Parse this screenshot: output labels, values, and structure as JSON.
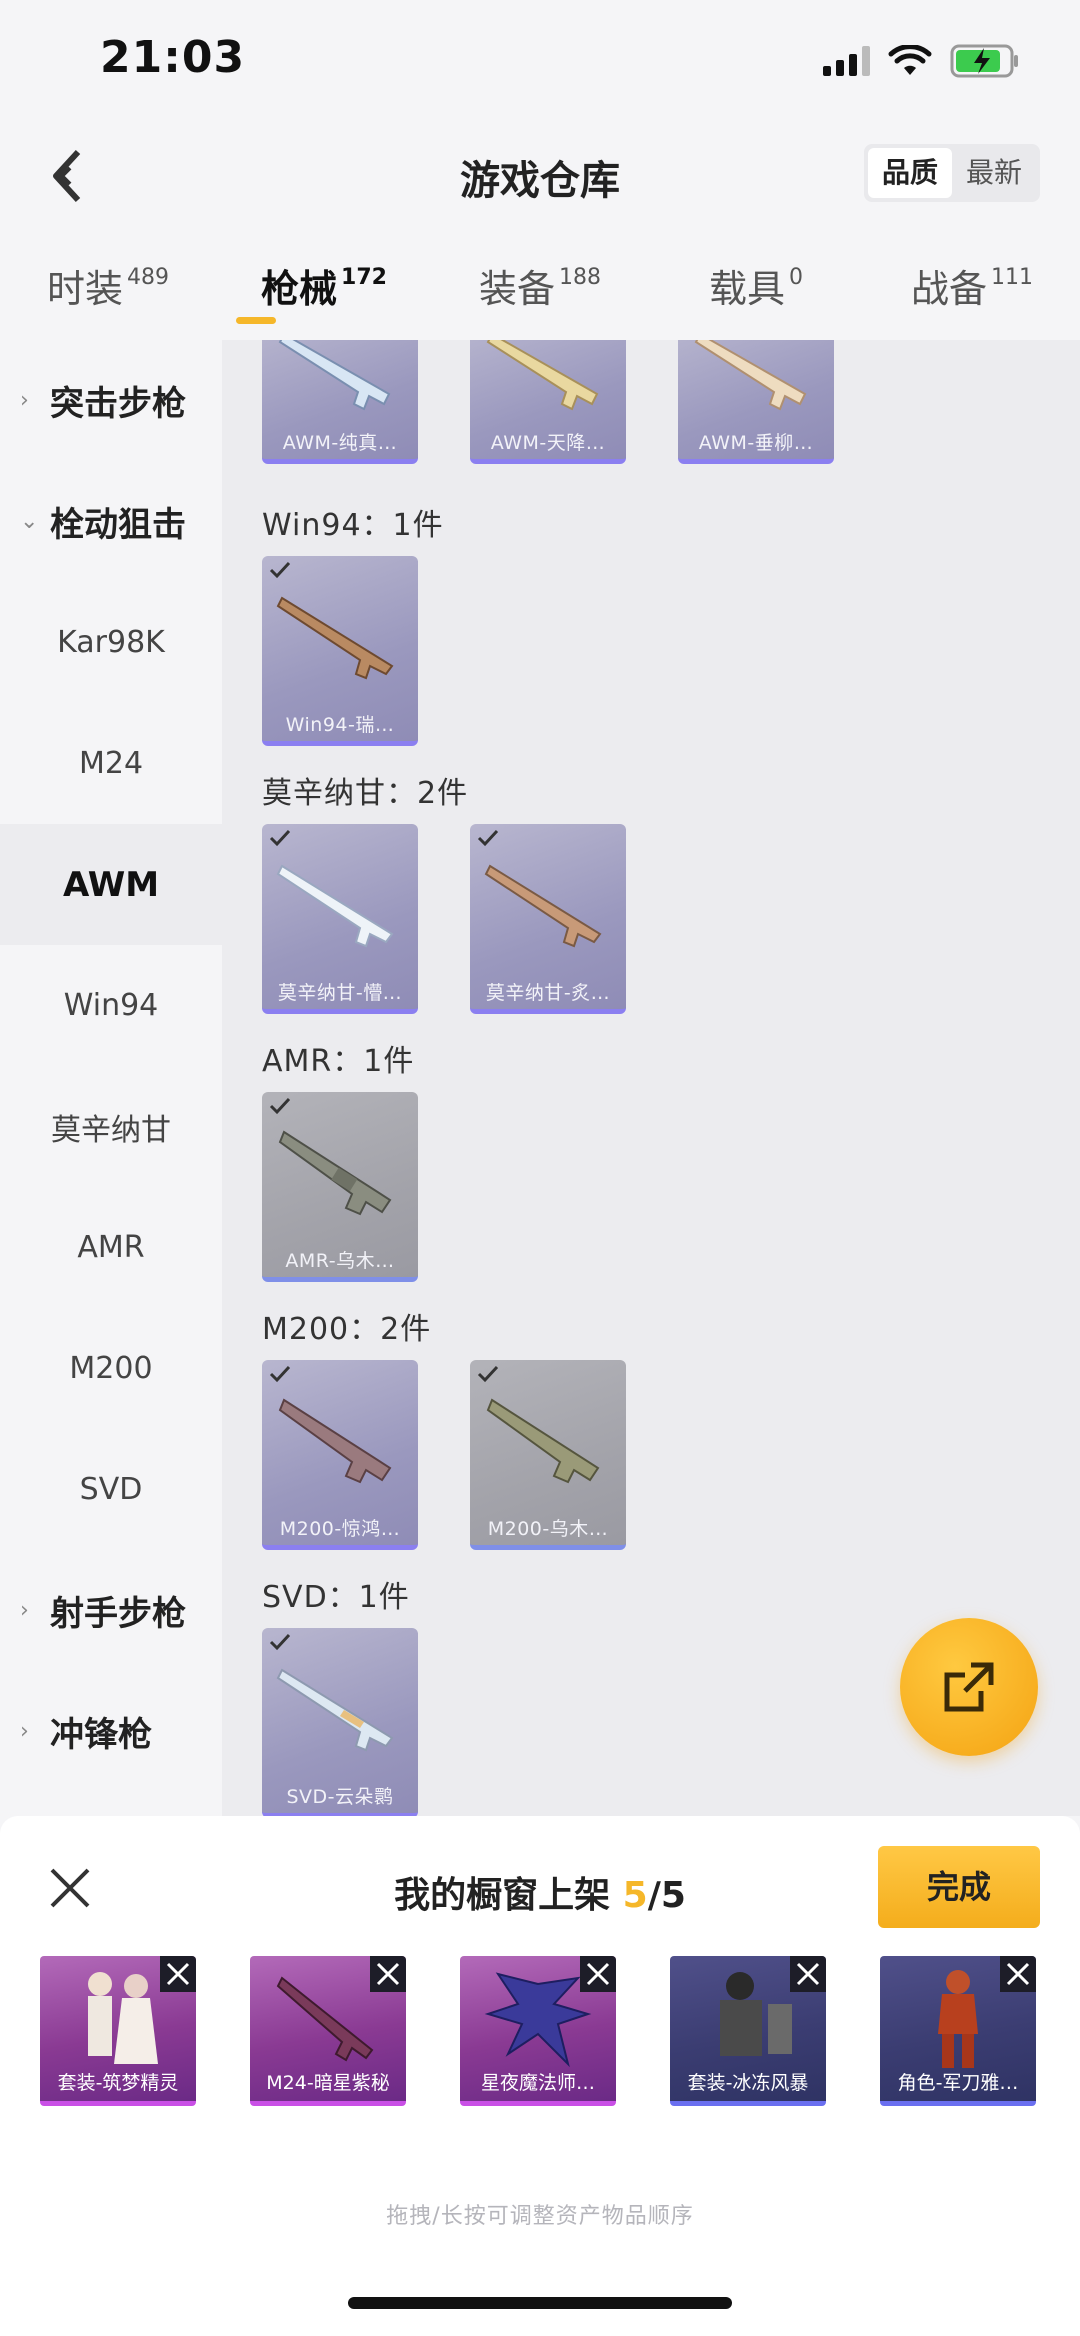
{
  "status": {
    "time": "21:03"
  },
  "header": {
    "title": "游戏仓库",
    "sort_options": [
      {
        "label": "品质",
        "active": true
      },
      {
        "label": "最新",
        "active": false
      }
    ]
  },
  "categories": [
    {
      "label": "时装",
      "count": "489",
      "active": false
    },
    {
      "label": "枪械",
      "count": "172",
      "active": true
    },
    {
      "label": "装备",
      "count": "188",
      "active": false
    },
    {
      "label": "载具",
      "count": "0",
      "active": false
    },
    {
      "label": "战备",
      "count": "111",
      "active": false
    }
  ],
  "sidebar": {
    "items": [
      {
        "label": "突击步枪",
        "type": "group",
        "expanded": false
      },
      {
        "label": "栓动狙击",
        "type": "group",
        "expanded": true
      },
      {
        "label": "Kar98K",
        "type": "sub"
      },
      {
        "label": "M24",
        "type": "sub"
      },
      {
        "label": "AWM",
        "type": "sub",
        "active": true
      },
      {
        "label": "Win94",
        "type": "sub"
      },
      {
        "label": "莫辛纳甘",
        "type": "sub"
      },
      {
        "label": "AMR",
        "type": "sub"
      },
      {
        "label": "M200",
        "type": "sub"
      },
      {
        "label": "SVD",
        "type": "sub"
      },
      {
        "label": "射手步枪",
        "type": "group",
        "expanded": false
      },
      {
        "label": "冲锋枪",
        "type": "group",
        "expanded": false
      }
    ]
  },
  "content": {
    "top_cards": [
      {
        "label": "AWM-纯真…"
      },
      {
        "label": "AWM-天降…"
      },
      {
        "label": "AWM-垂柳…"
      }
    ],
    "sections": [
      {
        "title": "Win94：1件",
        "items": [
          {
            "label": "Win94-瑞…",
            "checked": true
          }
        ]
      },
      {
        "title": "莫辛纳甘：2件",
        "items": [
          {
            "label": "莫辛纳甘-懵…",
            "checked": true
          },
          {
            "label": "莫辛纳甘-炙…",
            "checked": true
          }
        ]
      },
      {
        "title": "AMR：1件",
        "items": [
          {
            "label": "AMR-乌木…",
            "checked": true
          }
        ]
      },
      {
        "title": "M200：2件",
        "items": [
          {
            "label": "M200-惊鸿…",
            "checked": true
          },
          {
            "label": "M200-乌木…",
            "checked": true
          }
        ]
      },
      {
        "title": "SVD：1件",
        "items": [
          {
            "label": "SVD-云朵鹮",
            "checked": true
          }
        ]
      }
    ]
  },
  "panel": {
    "title_prefix": "我的橱窗上架 ",
    "count_current": "5",
    "count_sep_total": "/5",
    "done_label": "完成",
    "items": [
      {
        "label": "套装-筑梦精灵"
      },
      {
        "label": "M24-暗星紫秘"
      },
      {
        "label": "星夜魔法师…"
      },
      {
        "label": "套装-冰冻风暴"
      },
      {
        "label": "角色-军刀雅…"
      }
    ],
    "hint": "拖拽/长按可调整资产物品顺序"
  },
  "colors": {
    "accent": "#f5b72a",
    "rare_border": "#8b7ff0",
    "epic_border": "#c94fe6"
  }
}
